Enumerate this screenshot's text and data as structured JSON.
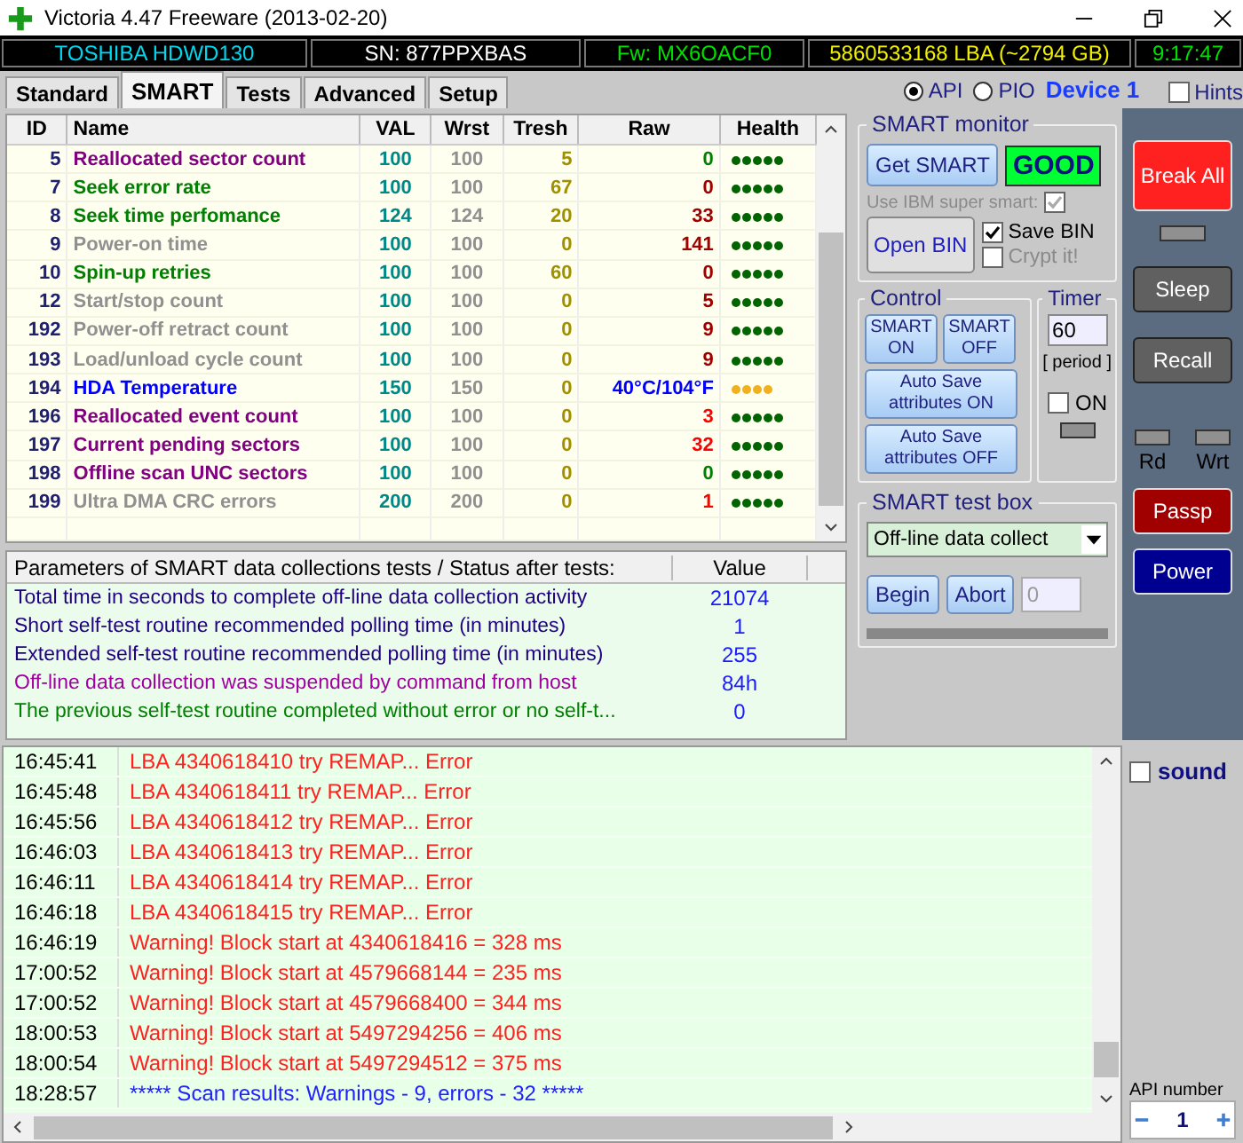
{
  "window": {
    "title": "Victoria 4.47  Freeware (2013-02-20)"
  },
  "info_bar": [
    {
      "text": "TOSHIBA HDWD130",
      "color": "#00d8f0"
    },
    {
      "text": "SN: 877PPXBAS",
      "color": "#ffffff"
    },
    {
      "text": "Fw: MX6OACF0",
      "color": "#00e000"
    },
    {
      "text": "5860533168 LBA (~2794 GB)",
      "color": "#f0f000"
    },
    {
      "text": "9:17:47",
      "color": "#00e000"
    }
  ],
  "tabs": [
    {
      "label": "Standard",
      "selected": false
    },
    {
      "label": "SMART",
      "selected": true
    },
    {
      "label": "Tests",
      "selected": false
    },
    {
      "label": "Advanced",
      "selected": false
    },
    {
      "label": "Setup",
      "selected": false
    }
  ],
  "interface": [
    {
      "label": "API",
      "selected": true
    },
    {
      "label": "PIO",
      "selected": false
    }
  ],
  "device": "Device 1",
  "hints": {
    "label": "Hints",
    "checked": false
  },
  "smart_table": {
    "columns": [
      "ID",
      "Name",
      "VAL",
      "Wrst",
      "Tresh",
      "Raw",
      "Health"
    ],
    "rows": [
      {
        "id": "5",
        "name": "Reallocated sector count",
        "color": "#800080",
        "val": "100",
        "wrst": "100",
        "tresh": "5",
        "raw": {
          "text": "0",
          "color": "#008000"
        },
        "stars": 5
      },
      {
        "id": "7",
        "name": "Seek error rate",
        "color": "#008000",
        "val": "100",
        "wrst": "100",
        "tresh": "67",
        "raw": {
          "text": "0",
          "color": "#a00000"
        },
        "stars": 5
      },
      {
        "id": "8",
        "name": "Seek time perfomance",
        "color": "#008000",
        "val": "124",
        "wrst": "124",
        "tresh": "20",
        "raw": {
          "text": "33",
          "color": "#a00000"
        },
        "stars": 5
      },
      {
        "id": "9",
        "name": "Power-on time",
        "color": "#909090",
        "val": "100",
        "wrst": "100",
        "tresh": "0",
        "raw": {
          "text": "141",
          "color": "#a00000"
        },
        "stars": 5
      },
      {
        "id": "10",
        "name": "Spin-up retries",
        "color": "#008000",
        "val": "100",
        "wrst": "100",
        "tresh": "60",
        "raw": {
          "text": "0",
          "color": "#a00000"
        },
        "stars": 5
      },
      {
        "id": "12",
        "name": "Start/stop count",
        "color": "#909090",
        "val": "100",
        "wrst": "100",
        "tresh": "0",
        "raw": {
          "text": "5",
          "color": "#a00000"
        },
        "stars": 5
      },
      {
        "id": "192",
        "name": "Power-off retract count",
        "color": "#909090",
        "val": "100",
        "wrst": "100",
        "tresh": "0",
        "raw": {
          "text": "9",
          "color": "#a00000"
        },
        "stars": 5
      },
      {
        "id": "193",
        "name": "Load/unload cycle count",
        "color": "#909090",
        "val": "100",
        "wrst": "100",
        "tresh": "0",
        "raw": {
          "text": "9",
          "color": "#a00000"
        },
        "stars": 5
      },
      {
        "id": "194",
        "name": "HDA Temperature",
        "color": "#0000ff",
        "val": "150",
        "wrst": "150",
        "tresh": "0",
        "raw": {
          "text": "40°C/104°F",
          "color": "#0000ff"
        },
        "stars": 4
      },
      {
        "id": "196",
        "name": "Reallocated event count",
        "color": "#800080",
        "val": "100",
        "wrst": "100",
        "tresh": "0",
        "raw": {
          "text": "3",
          "color": "#ff0000"
        },
        "stars": 5
      },
      {
        "id": "197",
        "name": "Current pending sectors",
        "color": "#800080",
        "val": "100",
        "wrst": "100",
        "tresh": "0",
        "raw": {
          "text": "32",
          "color": "#ff0000"
        },
        "stars": 5
      },
      {
        "id": "198",
        "name": "Offline scan UNC sectors",
        "color": "#800080",
        "val": "100",
        "wrst": "100",
        "tresh": "0",
        "raw": {
          "text": "0",
          "color": "#008000"
        },
        "stars": 5
      },
      {
        "id": "199",
        "name": "Ultra DMA CRC errors",
        "color": "#909090",
        "val": "200",
        "wrst": "200",
        "tresh": "0",
        "raw": {
          "text": "1",
          "color": "#ff0000"
        },
        "stars": 5
      }
    ]
  },
  "params": {
    "columns": [
      "Parameters of SMART data collections tests / Status after tests:",
      "Value"
    ],
    "rows": [
      {
        "text": "Total time in seconds to complete off-line data collection activity",
        "value": "21074",
        "color": "#200080"
      },
      {
        "text": "Short self-test routine recommended polling time (in minutes)",
        "value": "1",
        "color": "#200080"
      },
      {
        "text": "Extended self-test routine recommended polling time (in minutes)",
        "value": "255",
        "color": "#200080"
      },
      {
        "text": "Off-line data collection was suspended by command from host",
        "value": "84h",
        "color": "#a000a0"
      },
      {
        "text": "The previous self-test routine completed without error or no self-t...",
        "value": "0",
        "color": "#008000"
      }
    ]
  },
  "smart_monitor": {
    "title": "SMART monitor",
    "get_smart": "Get SMART",
    "status": {
      "text": "GOOD",
      "kind": "good"
    },
    "ibm": {
      "label": "Use IBM super smart:",
      "checked": true,
      "disabled": true
    },
    "open_bin": "Open BIN",
    "save_bin": {
      "label": "Save BIN",
      "checked": true,
      "disabled": false
    },
    "crypt": {
      "label": "Crypt it!",
      "checked": false,
      "disabled": true
    }
  },
  "control": {
    "title": "Control",
    "buttons": [
      "SMART ON",
      "SMART OFF",
      "Auto Save attributes ON",
      "Auto Save attributes OFF"
    ]
  },
  "timer": {
    "title": "Timer",
    "value": "60",
    "caption": "[ period ]",
    "on": {
      "label": "ON",
      "checked": false
    }
  },
  "test_box": {
    "title": "SMART test box",
    "selection": "Off-line data collect",
    "begin": "Begin",
    "abort": "Abort",
    "counter": "0",
    "level": 0
  },
  "side_buttons": {
    "break_all": "Break All",
    "sleep": "Sleep",
    "recall": "Recall",
    "rd": "Rd",
    "wrt": "Wrt",
    "passp": "Passp",
    "power": "Power"
  },
  "log": [
    {
      "time": "16:45:41",
      "text": "LBA 4340618410 try REMAP... Error",
      "kind": "error"
    },
    {
      "time": "16:45:48",
      "text": "LBA 4340618411 try REMAP... Error",
      "kind": "error"
    },
    {
      "time": "16:45:56",
      "text": "LBA 4340618412 try REMAP... Error",
      "kind": "error"
    },
    {
      "time": "16:46:03",
      "text": "LBA 4340618413 try REMAP... Error",
      "kind": "error"
    },
    {
      "time": "16:46:11",
      "text": "LBA 4340618414 try REMAP... Error",
      "kind": "error"
    },
    {
      "time": "16:46:18",
      "text": "LBA 4340618415 try REMAP... Error",
      "kind": "error"
    },
    {
      "time": "16:46:19",
      "text": "Warning! Block start at 4340618416 = 328 ms",
      "kind": "error"
    },
    {
      "time": "17:00:52",
      "text": "Warning! Block start at 4579668144 = 235 ms",
      "kind": "error"
    },
    {
      "time": "17:00:52",
      "text": "Warning! Block start at 4579668400 = 344 ms",
      "kind": "error"
    },
    {
      "time": "18:00:53",
      "text": "Warning! Block start at 5497294256 = 406 ms",
      "kind": "error"
    },
    {
      "time": "18:00:54",
      "text": "Warning! Block start at 5497294512 = 375 ms",
      "kind": "error"
    },
    {
      "time": "18:28:57",
      "text": "***** Scan results: Warnings - 9, errors - 32 *****",
      "kind": "result"
    }
  ],
  "sound": {
    "label": "sound",
    "checked": false
  },
  "api_number": {
    "label": "API number",
    "value": "1"
  }
}
